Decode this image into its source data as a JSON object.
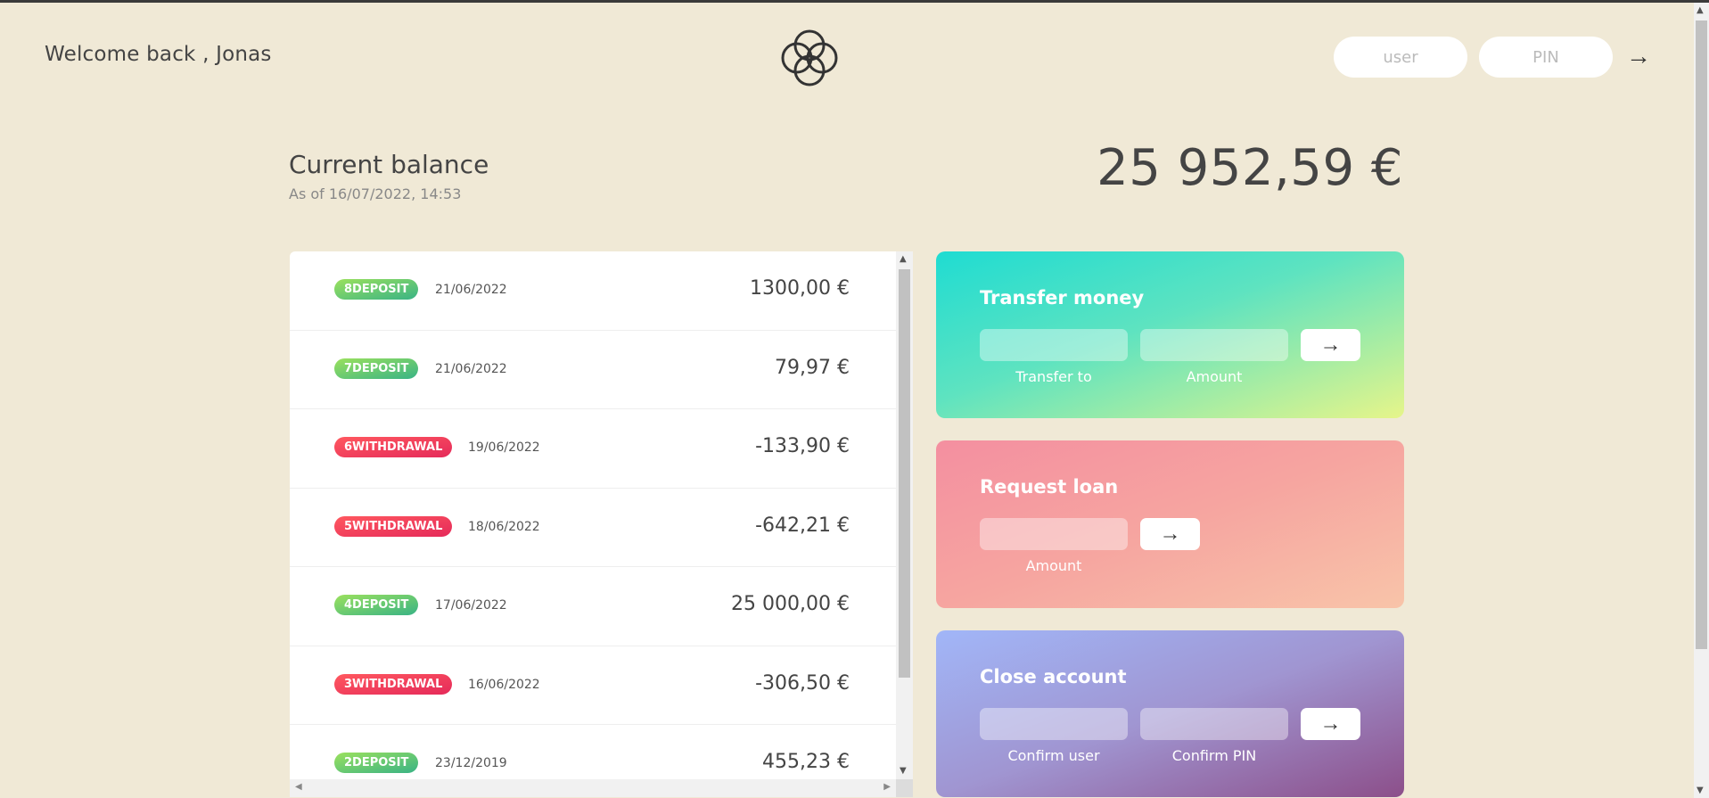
{
  "nav": {
    "welcome": "Welcome back , Jonas",
    "user_placeholder": "user",
    "pin_placeholder": "PIN",
    "login_arrow": "→"
  },
  "balance": {
    "label": "Current balance",
    "date": "As of 16/07/2022, 14:53",
    "value": "25 952,59 €"
  },
  "movements": [
    {
      "type": "8DEPOSIT",
      "kind": "deposit",
      "date": "21/06/2022",
      "value": "1300,00 €"
    },
    {
      "type": "7DEPOSIT",
      "kind": "deposit",
      "date": "21/06/2022",
      "value": "79,97 €"
    },
    {
      "type": "6WITHDRAWAL",
      "kind": "withdrawal",
      "date": "19/06/2022",
      "value": "-133,90 €"
    },
    {
      "type": "5WITHDRAWAL",
      "kind": "withdrawal",
      "date": "18/06/2022",
      "value": "-642,21 €"
    },
    {
      "type": "4DEPOSIT",
      "kind": "deposit",
      "date": "17/06/2022",
      "value": "25 000,00 €"
    },
    {
      "type": "3WITHDRAWAL",
      "kind": "withdrawal",
      "date": "16/06/2022",
      "value": "-306,50 €"
    },
    {
      "type": "2DEPOSIT",
      "kind": "deposit",
      "date": "23/12/2019",
      "value": "455,23 €"
    }
  ],
  "operations": {
    "transfer": {
      "title": "Transfer money",
      "label_to": "Transfer to",
      "label_amount": "Amount",
      "btn": "→"
    },
    "loan": {
      "title": "Request loan",
      "label_amount": "Amount",
      "btn": "→"
    },
    "close": {
      "title": "Close account",
      "label_user": "Confirm user",
      "label_pin": "Confirm PIN",
      "btn": "→"
    }
  },
  "colors": {
    "background": "#f0e9d6",
    "deposit": "#39b385",
    "withdrawal": "#e52a5a"
  }
}
